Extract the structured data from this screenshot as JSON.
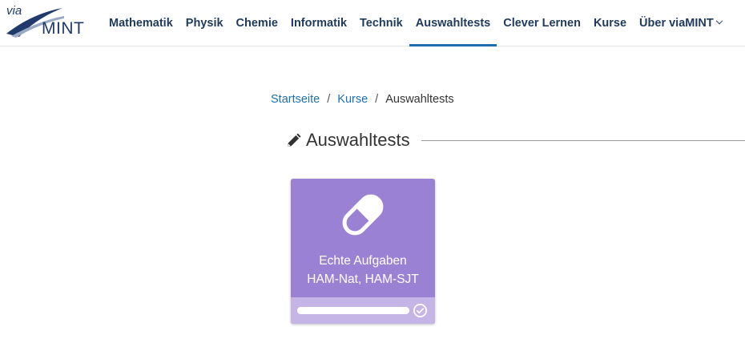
{
  "logo": {
    "via": "via",
    "mint": "MINT",
    "color": "#1f3a6b"
  },
  "nav": {
    "items": [
      {
        "label": "Mathematik"
      },
      {
        "label": "Physik"
      },
      {
        "label": "Chemie"
      },
      {
        "label": "Informatik"
      },
      {
        "label": "Technik"
      },
      {
        "label": "Auswahltests",
        "active": true
      },
      {
        "label": "Clever Lernen"
      },
      {
        "label": "Kurse"
      },
      {
        "label": "Über viaMINT",
        "dropdown": true
      }
    ],
    "accent_color": "#1f6fb0"
  },
  "breadcrumb": {
    "items": [
      "Startseite",
      "Kurse",
      "Auswahltests"
    ],
    "separator": "/"
  },
  "section": {
    "icon": "pencil-icon",
    "title": "Auswahltests"
  },
  "card": {
    "icon": "pill-icon",
    "title_line1": "Echte Aufgaben",
    "title_line2": "HAM-Nat, HAM-SJT",
    "progress": 1.0,
    "status_icon": "check-circle-icon",
    "color": "#9b81d4",
    "footer_color": "#c5b4e6"
  }
}
